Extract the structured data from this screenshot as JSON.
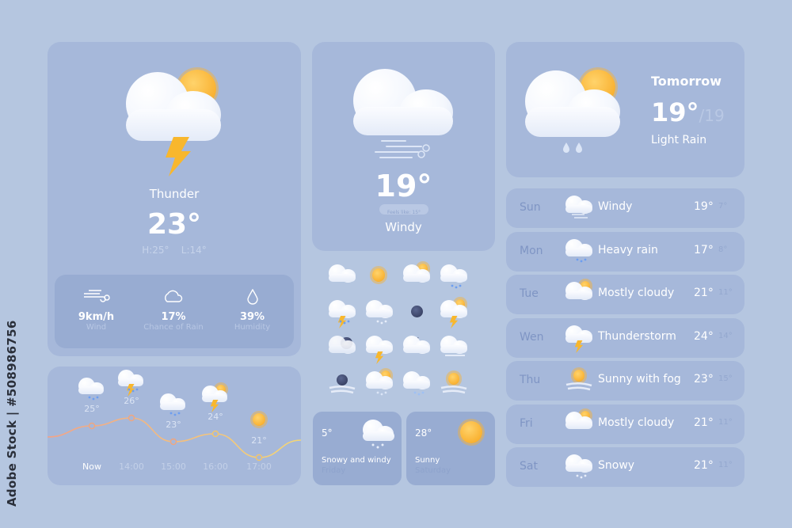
{
  "watermark": "Adobe Stock | #508986756",
  "current": {
    "condition": "Thunder",
    "temperature": "23°",
    "high": "H:25°",
    "low": "L:14°",
    "icon": "cloud-sun-thunder-icon",
    "stats": [
      {
        "value": "9km/h",
        "label": "Wind",
        "icon": "wind-icon"
      },
      {
        "value": "17%",
        "label": "Chance of Rain",
        "icon": "cloud-outline-icon"
      },
      {
        "value": "39%",
        "label": "Humidity",
        "icon": "droplet-icon"
      }
    ]
  },
  "hourly": {
    "items": [
      {
        "time": "Now",
        "temp": "25°",
        "temp_value": 25,
        "icon": "cloud-rain-icon"
      },
      {
        "time": "14:00",
        "temp": "26°",
        "temp_value": 26,
        "icon": "cloud-thunder-rain-icon"
      },
      {
        "time": "15:00",
        "temp": "23°",
        "temp_value": 23,
        "icon": "cloud-rain-icon"
      },
      {
        "time": "16:00",
        "temp": "24°",
        "temp_value": 24,
        "icon": "cloud-sun-thunder-icon"
      },
      {
        "time": "17:00",
        "temp": "21°",
        "temp_value": 21,
        "icon": "sun-icon"
      }
    ]
  },
  "windy_card": {
    "temperature": "19°",
    "feels_like": "Feels like: 15°",
    "condition": "Windy",
    "icon": "cloud-wind-icon"
  },
  "icon_grid": [
    "cloud-icon",
    "sun-icon",
    "cloud-sun-icon",
    "cloud-rain-icon",
    "cloud-thunder-rain-icon",
    "cloud-snow-icon",
    "moon-dark-icon",
    "cloud-sun-thunder-icon",
    "cloud-dark-moon-icon",
    "cloud-thunder-icon",
    "cloud-moon-stars-icon",
    "cloud-fog-icon",
    "moon-fog-icon",
    "cloud-sun-rain-icon",
    "cloud-snow-rain-icon",
    "sun-fog-icon"
  ],
  "mini_cards": [
    {
      "temp": "5°",
      "condition": "Snowy and windy",
      "day": "Friday",
      "icon": "cloud-snow-icon"
    },
    {
      "temp": "28°",
      "condition": "Sunny",
      "day": "Saturday",
      "icon": "sun-icon"
    }
  ],
  "tomorrow": {
    "title": "Tomorrow",
    "temperature": "19°",
    "secondary": "/19",
    "condition": "Light Rain",
    "icon": "cloud-sun-rain-icon"
  },
  "weekly": [
    {
      "day": "Sun",
      "condition": "Windy",
      "high": "19°",
      "low": "7°",
      "icon": "cloud-wind-icon"
    },
    {
      "day": "Mon",
      "condition": "Heavy rain",
      "high": "17°",
      "low": "8°",
      "icon": "cloud-rain-icon"
    },
    {
      "day": "Tue",
      "condition": "Mostly cloudy",
      "high": "21°",
      "low": "11°",
      "icon": "cloud-sun-icon"
    },
    {
      "day": "Wen",
      "condition": "Thunderstorm",
      "high": "24°",
      "low": "14°",
      "icon": "cloud-thunder-icon"
    },
    {
      "day": "Thu",
      "condition": "Sunny with fog",
      "high": "23°",
      "low": "15°",
      "icon": "sun-fog-icon"
    },
    {
      "day": "Fri",
      "condition": "Mostly cloudy",
      "high": "21°",
      "low": "11°",
      "icon": "cloud-sun-icon"
    },
    {
      "day": "Sat",
      "condition": "Snowy",
      "high": "21°",
      "low": "11°",
      "icon": "cloud-snow-icon"
    }
  ],
  "colors": {
    "background": "#b5c6e0",
    "card": "#a6b8da",
    "card_dark": "#98acd2",
    "sun": "#f9b233",
    "curve_start": "#f2a488",
    "curve_end": "#f5d774"
  }
}
